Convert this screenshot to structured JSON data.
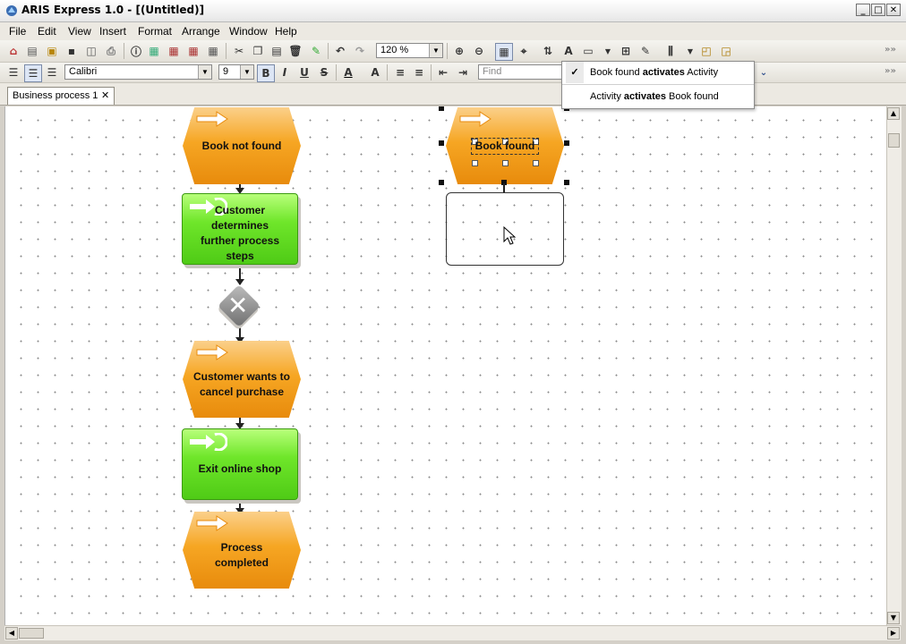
{
  "window": {
    "title": "ARIS Express 1.0 - [(Untitled)]",
    "controls": [
      "_",
      "□",
      "✕"
    ]
  },
  "menu": [
    "File",
    "Edit",
    "View",
    "Insert",
    "Format",
    "Arrange",
    "Window",
    "Help"
  ],
  "toolbar": {
    "zoom": "120 %",
    "overflow": "»»"
  },
  "format_bar": {
    "font": "Calibri",
    "size": "9",
    "bold": "B",
    "italic": "I",
    "underline": "U",
    "strike": "S",
    "find_placeholder": "Find",
    "overflow": "»»"
  },
  "tabs": [
    {
      "label": "Business process 1",
      "close": "✕"
    }
  ],
  "popup": {
    "items": [
      {
        "pre": "Book found ",
        "bold": "activates",
        "post": " Activity",
        "checked": true
      },
      {
        "pre": "Activity ",
        "bold": "activates",
        "post": " Book found",
        "checked": false
      }
    ],
    "check": "✓"
  },
  "diagram": {
    "nodes": [
      {
        "type": "event",
        "label": "Book not found"
      },
      {
        "type": "function",
        "label": "Customer determines further process steps"
      },
      {
        "type": "xor-connector",
        "label": "✕"
      },
      {
        "type": "event",
        "label": "Customer wants to cancel purchase"
      },
      {
        "type": "function",
        "label": "Exit online shop"
      },
      {
        "type": "event",
        "label": "Process completed"
      },
      {
        "type": "event",
        "label": "Book found"
      }
    ]
  },
  "colors": {
    "event": "#f6a623",
    "function": "#6fe62a",
    "connector": "#7a7a7a"
  }
}
